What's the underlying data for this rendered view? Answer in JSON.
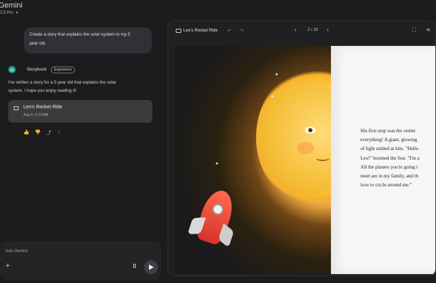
{
  "app": {
    "title": "Gemini",
    "model": "2.5 Pro"
  },
  "chat": {
    "user_message_line1": "Create a story that explains the solar system to my 5",
    "user_message_line2": "year old.",
    "assistant": {
      "name": "Storybook",
      "badge": "Experiment",
      "text_line1": "I've written a story for a 5 year old that explains the solar",
      "text_line2": "system. I hope you enjoy reading it!"
    },
    "story_card": {
      "title": "Leo's Rocket Ride",
      "date": "Aug 5, 9:13 AM"
    },
    "input_placeholder": "Ask Gemini"
  },
  "viewer": {
    "title": "Leo's Rocket Ride",
    "page": "2 / 10",
    "page_text_lines": [
      "His first stop was the center",
      "everything! A giant, glowing",
      "of light smiled at him. \"Hello",
      "Leo!\" boomed the Sun. \"I'm a",
      "All the planets you're going t",
      "meet are in my family, and th",
      "love to circle around me.\""
    ]
  },
  "icons": {
    "model_chevron": "chevron-down-icon",
    "story_card": "book-icon",
    "actions": [
      "thumbs-up-icon",
      "thumbs-down-icon",
      "share-icon",
      "more-icon"
    ],
    "input_plus": "plus-icon",
    "input_mic": "mic-icon",
    "input_send": "send-icon",
    "viewer_undo": "undo-icon",
    "viewer_redo": "redo-icon",
    "viewer_prev": "chevron-left-icon",
    "viewer_next": "chevron-right-icon",
    "viewer_fullscreen": "fullscreen-icon",
    "viewer_share": "share-icon"
  },
  "colors": {
    "background": "#1b1c1d",
    "panel": "#1f2022",
    "bubble": "#303134",
    "accent": "#1a8f86"
  }
}
